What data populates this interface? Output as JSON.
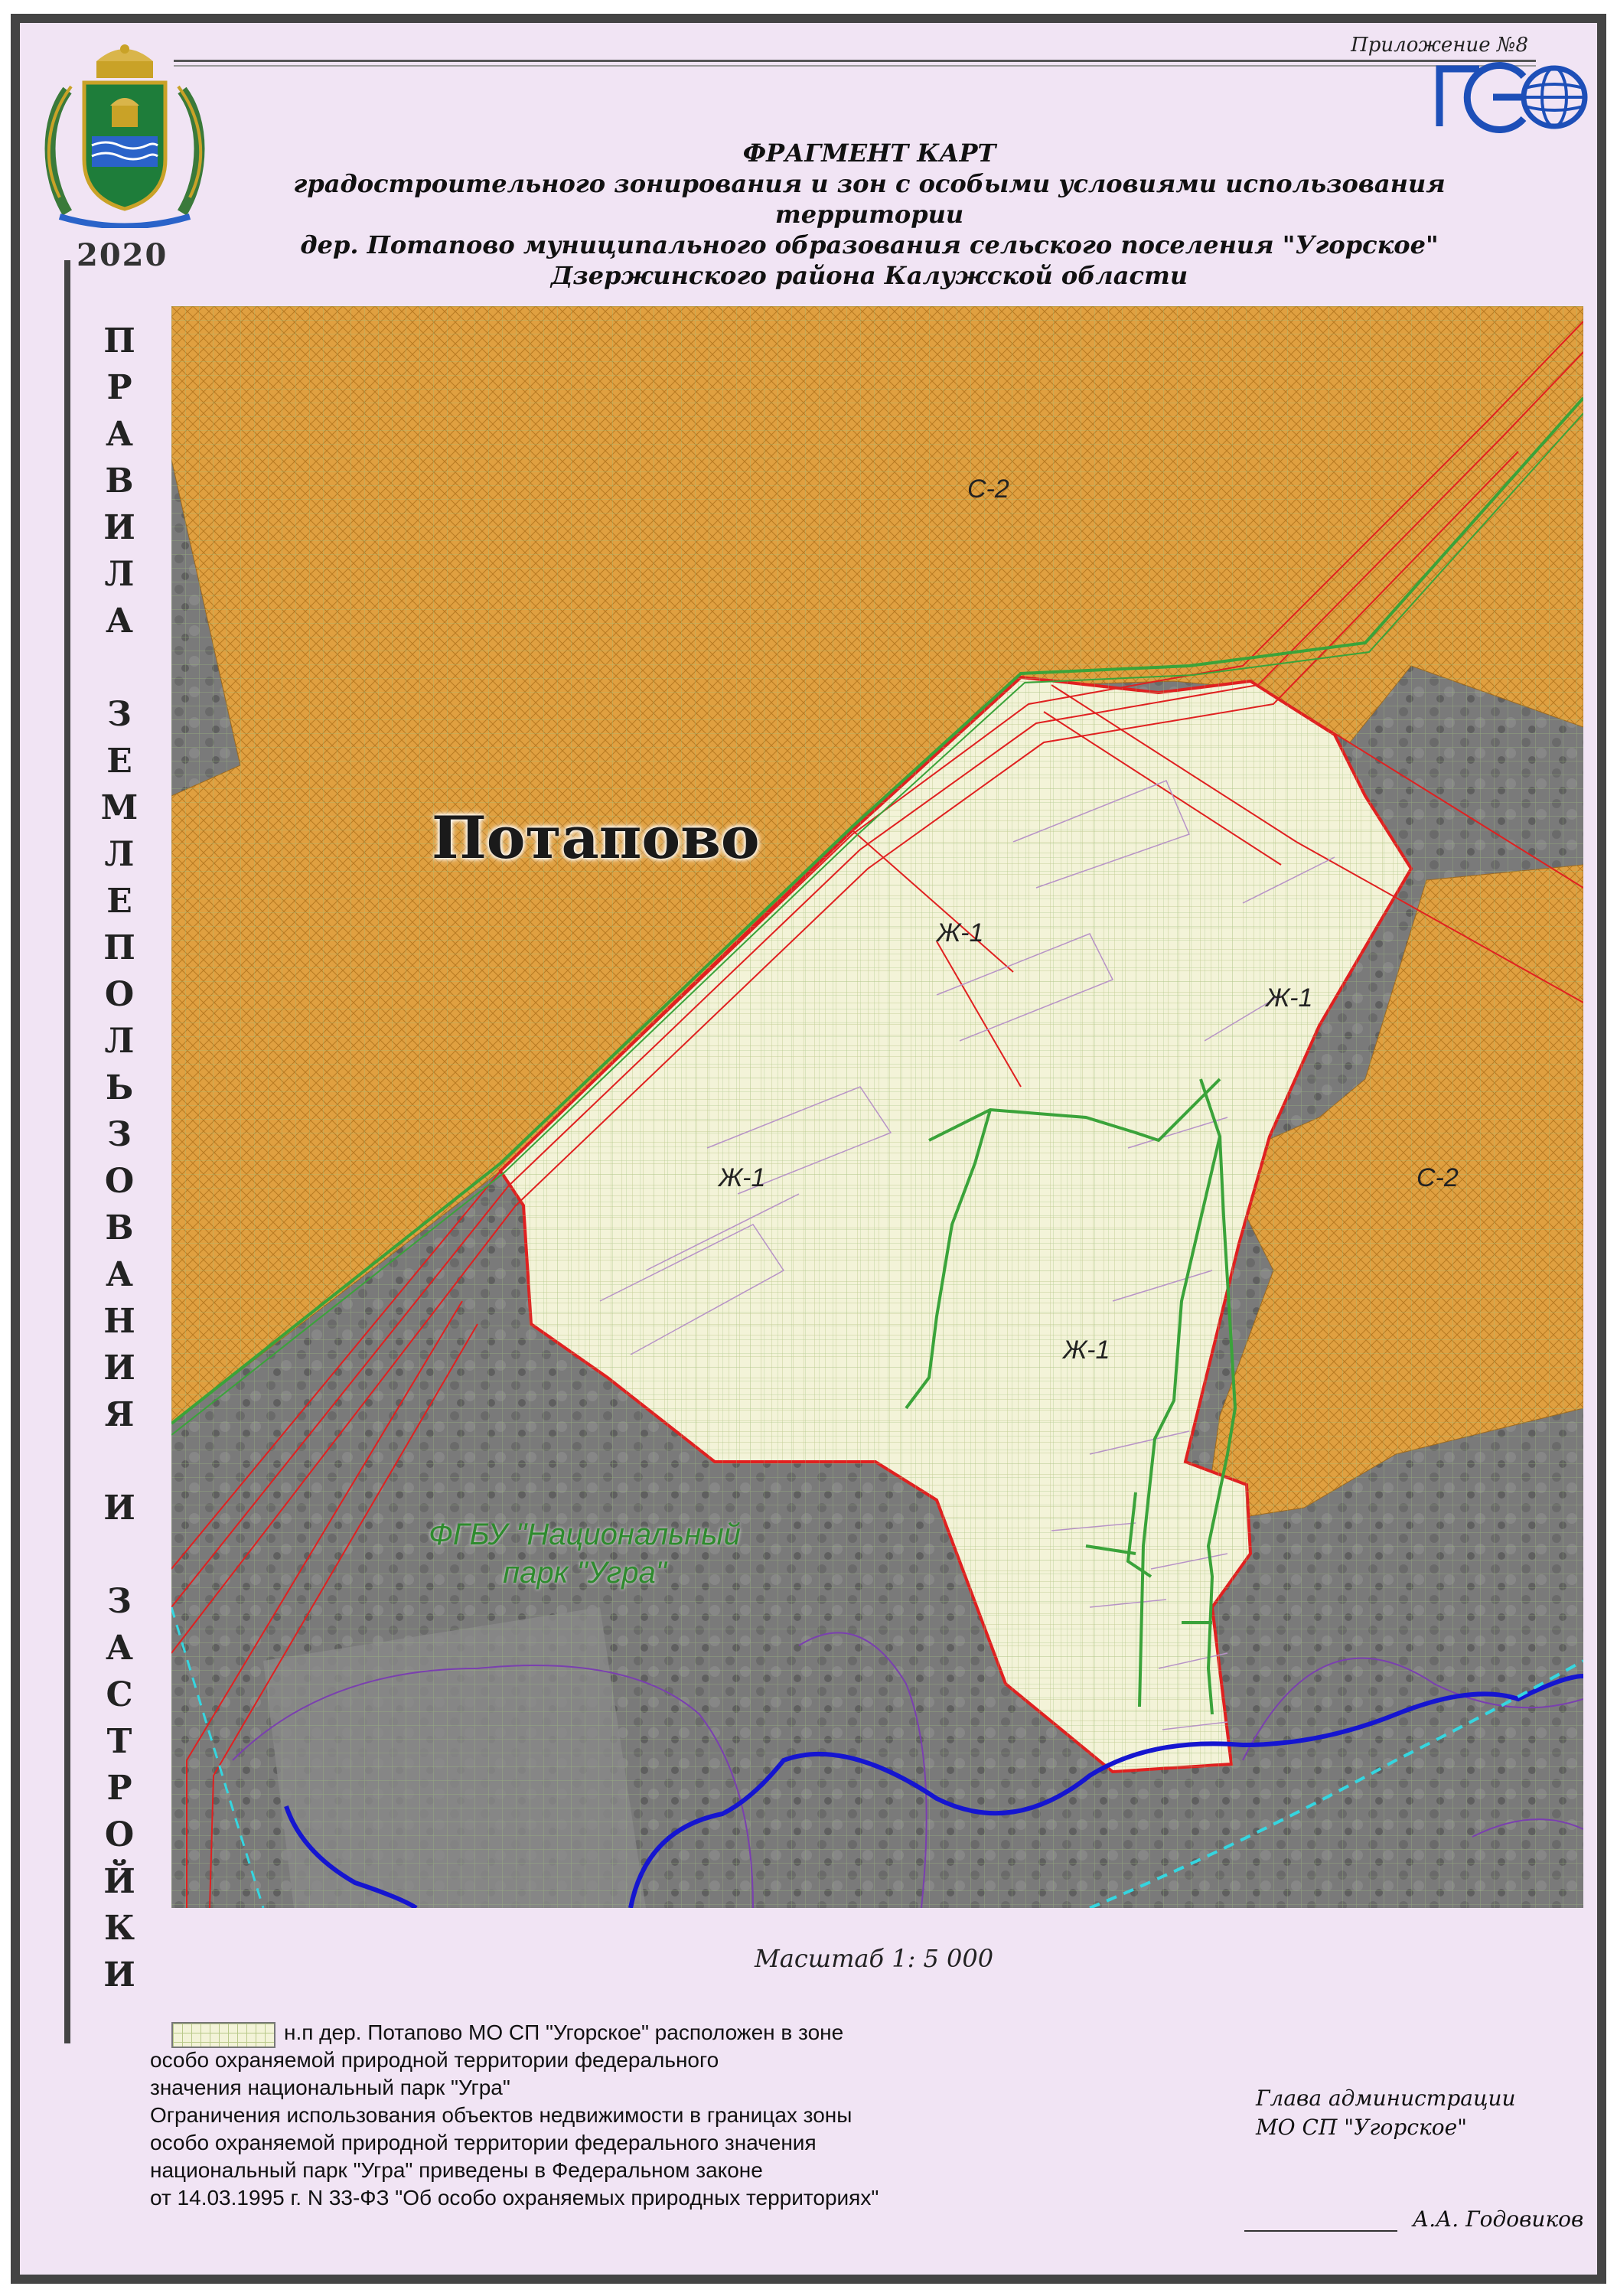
{
  "header": {
    "appendix": "Приложение №8",
    "year": "2020",
    "title_lines": [
      "ФРАГМЕНТ КАРТ",
      "градостроительного зонирования и зон с особыми условиями использования  территории",
      "дер. Потапово  муниципального образования  сельского поселения \"Угорское\"",
      "Дзержинского района Калужской области"
    ],
    "vertical_title": [
      "П",
      "Р",
      "А",
      "В",
      "И",
      "Л",
      "А",
      " ",
      "З",
      "Е",
      "М",
      "Л",
      "Е",
      "П",
      "О",
      "Л",
      "Ь",
      "З",
      "О",
      "В",
      "А",
      "Н",
      "И",
      "Я",
      " ",
      "И",
      " ",
      "З",
      "А",
      "С",
      "Т",
      "Р",
      "О",
      "Й",
      "К",
      "И"
    ],
    "logo": "geo-logo-icon",
    "emblem": "kaluga-coat-of-arms-icon"
  },
  "map": {
    "settlement_label": "Потапово",
    "zone_labels": {
      "c2_top": "С-2",
      "c2_right": "С-2",
      "zh1_a": "Ж-1",
      "zh1_b": "Ж-1",
      "zh1_c": "Ж-1",
      "zh1_d": "Ж-1"
    },
    "park_label_lines": [
      "ФГБУ \"Национальный",
      "парк \"Угра\""
    ],
    "colors": {
      "c2_zone": "#e0a040",
      "zh1_zone": "#f3f3d8",
      "boundary": "#e02020",
      "utility": "#3aa33a",
      "forest": "#7a7a7a",
      "river": "#1515d0",
      "park_label": "#2e8b2e"
    }
  },
  "scale": "Масштаб 1: 5 000",
  "legend": {
    "lines": [
      "н.п дер. Потапово  МО СП \"Угорское\" расположен в зоне",
      "особо охраняемой природной территории федерального",
      "значения национальный парк \"Угра\"",
      "Ограничения использования объектов недвижимости в границах зоны",
      "особо охраняемой природной территории федерального значения",
      "национальный парк \"Угра\" приведены в Федеральном законе",
      "от 14.03.1995 г. N 33-ФЗ \"Об особо охраняемых природных территориях\""
    ]
  },
  "signature": {
    "line1": "Глава администрации",
    "line2": "МО СП \"Угорское\"",
    "name": "А.А. Годовиков"
  }
}
